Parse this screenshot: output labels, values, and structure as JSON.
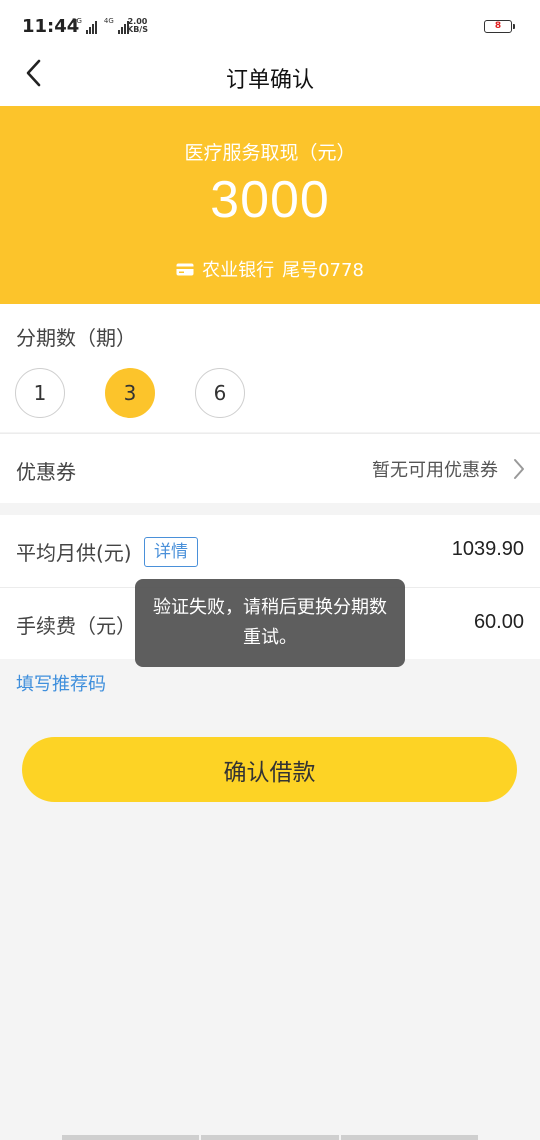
{
  "status_bar": {
    "time": "11:44",
    "signal1_label": "3G",
    "signal2_label": "4G",
    "net_speed_value": "2.00",
    "net_speed_unit": "KB/S",
    "battery": "8",
    "battery_color": "#e02020"
  },
  "nav": {
    "title": "订单确认",
    "back_icon": "chevron-left-icon"
  },
  "banner": {
    "label": "医疗服务取现（元）",
    "amount": "3000",
    "bank_name": "农业银行",
    "card_tail": "尾号0778",
    "card_icon": "card-icon",
    "color": "#fcc42b"
  },
  "installment": {
    "title": "分期数（期）",
    "options": [
      "1",
      "3",
      "6"
    ],
    "selected": "3"
  },
  "coupon": {
    "label": "优惠券",
    "value": "暂无可用优惠券"
  },
  "summary": {
    "monthly_label": "平均月供(元)",
    "detail_label": "详情",
    "monthly_value": "1039.90",
    "fee_label": "手续费（元）",
    "fee_value": "60.00"
  },
  "referral": {
    "label": "填写推荐码"
  },
  "confirm": {
    "label": "确认借款",
    "color": "#fdd325"
  },
  "toast": {
    "message": "验证失败，请稍后更换分期数重试。"
  }
}
